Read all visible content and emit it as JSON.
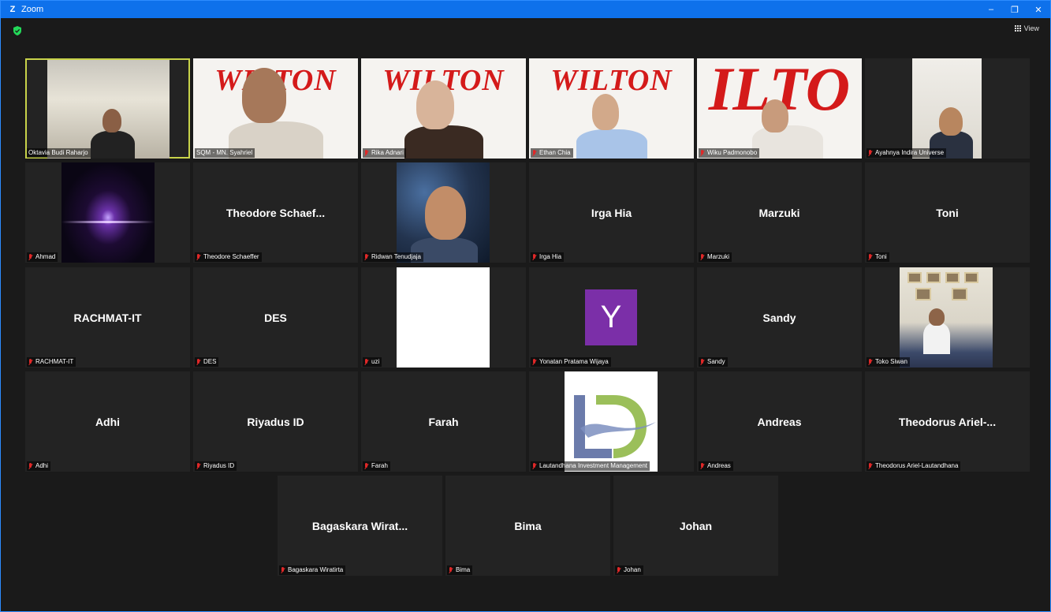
{
  "window": {
    "app_logo": "Z",
    "title": "Zoom",
    "controls": {
      "minimize": "–",
      "restore": "❐",
      "close": "✕"
    }
  },
  "topbar": {
    "view_label": "View",
    "security_icon": "shield-icon"
  },
  "colors": {
    "title_bar": "#0e71eb",
    "background": "#1a1a1a",
    "tile": "#232323",
    "active_speaker_border": "#c8d34a",
    "muted_mic": "#e02828"
  },
  "tiles": [
    {
      "name": "Oktavia Budi Raharjo",
      "center": "",
      "muted": false,
      "active": true,
      "video": "office"
    },
    {
      "name": "SQM - MN. Syahriel",
      "center": "",
      "muted": false,
      "video": "wilton",
      "banner": "WILTON"
    },
    {
      "name": "Rika Adnari",
      "center": "",
      "muted": true,
      "video": "wilton",
      "banner": "WILTON"
    },
    {
      "name": "Ethan Chia",
      "center": "",
      "muted": true,
      "video": "wilton",
      "banner": "WILTON"
    },
    {
      "name": "Wiku Padmonobo",
      "center": "",
      "muted": true,
      "video": "wilton-big",
      "banner": "ILTO"
    },
    {
      "name": "Ayahnya Indira Universe",
      "center": "",
      "muted": true,
      "video": "person-room"
    },
    {
      "name": "Ahmad",
      "center": "",
      "muted": true,
      "video": "space"
    },
    {
      "name": "Theodore Schaeffer",
      "center": "Theodore  Schaef...",
      "muted": true
    },
    {
      "name": "Ridwan Tenudjaja",
      "center": "",
      "muted": true,
      "video": "night"
    },
    {
      "name": "Irga Hia",
      "center": "Irga Hia",
      "muted": true
    },
    {
      "name": "Marzuki",
      "center": "Marzuki",
      "muted": true
    },
    {
      "name": "Toni",
      "center": "Toni",
      "muted": true
    },
    {
      "name": "RACHMAT-IT",
      "center": "RACHMAT-IT",
      "muted": true
    },
    {
      "name": "DES",
      "center": "DES",
      "muted": true
    },
    {
      "name": "uzi",
      "center": "",
      "muted": true,
      "video": "white"
    },
    {
      "name": "Yonatan Pratama Wijaya",
      "center": "",
      "muted": true,
      "video": "avatar",
      "avatar_letter": "Y"
    },
    {
      "name": "Sandy",
      "center": "Sandy",
      "muted": true
    },
    {
      "name": "Toko Siwan",
      "center": "",
      "muted": true,
      "video": "room"
    },
    {
      "name": "Adhi",
      "center": "Adhi",
      "muted": true
    },
    {
      "name": "Riyadus ID",
      "center": "Riyadus ID",
      "muted": true
    },
    {
      "name": "Farah",
      "center": "Farah",
      "muted": true
    },
    {
      "name": "Lautandhana Investment Management",
      "center": "",
      "muted": true,
      "video": "logo"
    },
    {
      "name": "Andreas",
      "center": "Andreas",
      "muted": true
    },
    {
      "name": "Theodorus Ariel-Lautandhana",
      "center": "Theodorus  Ariel-...",
      "muted": true
    },
    {
      "name": "Bagaskara Wiratirta",
      "center": "Bagaskara  Wirat...",
      "muted": true
    },
    {
      "name": "Bima",
      "center": "Bima",
      "muted": true
    },
    {
      "name": "Johan",
      "center": "Johan",
      "muted": true
    }
  ]
}
